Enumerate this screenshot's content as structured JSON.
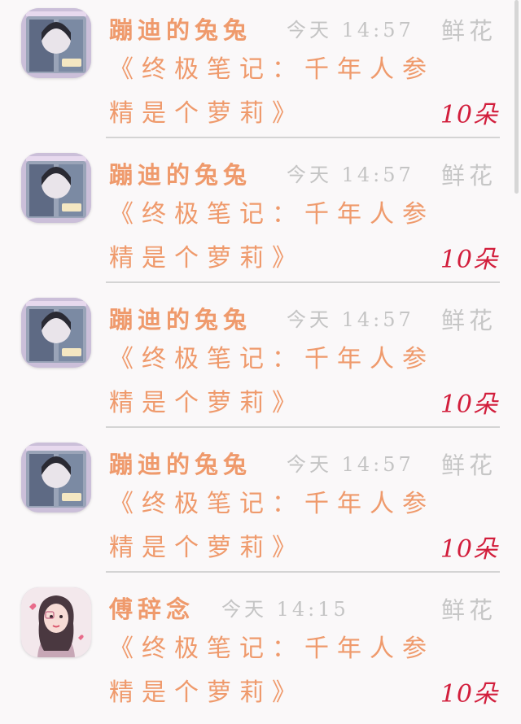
{
  "items": [
    {
      "sender": "蹦迪的兔兔",
      "time": "今天 14:57",
      "gift_type": "鲜花",
      "book_line1": "《终极笔记：千年人参",
      "book_line2": "精是个萝莉》",
      "amount": "10朵",
      "avatar": "avatar-anime-girl-icon"
    },
    {
      "sender": "蹦迪的兔兔",
      "time": "今天 14:57",
      "gift_type": "鲜花",
      "book_line1": "《终极笔记：千年人参",
      "book_line2": "精是个萝莉》",
      "amount": "10朵",
      "avatar": "avatar-anime-girl-icon"
    },
    {
      "sender": "蹦迪的兔兔",
      "time": "今天 14:57",
      "gift_type": "鲜花",
      "book_line1": "《终极笔记：千年人参",
      "book_line2": "精是个萝莉》",
      "amount": "10朵",
      "avatar": "avatar-anime-girl-icon"
    },
    {
      "sender": "蹦迪的兔兔",
      "time": "今天 14:57",
      "gift_type": "鲜花",
      "book_line1": "《终极笔记：千年人参",
      "book_line2": "精是个萝莉》",
      "amount": "10朵",
      "avatar": "avatar-anime-girl-icon"
    },
    {
      "sender": "傅辞念",
      "time": "今天 14:15",
      "gift_type": "鲜花",
      "book_line1": "《终极笔记：千年人参",
      "book_line2": "精是个萝莉》",
      "amount": "10朵",
      "avatar": "avatar-girl-heart-icon"
    }
  ],
  "colors": {
    "accent": "#ef9a6c",
    "amount": "#d21e3c",
    "muted": "#c4c4c4",
    "divider": "#d4d4d4",
    "background": "#faf8f9"
  }
}
